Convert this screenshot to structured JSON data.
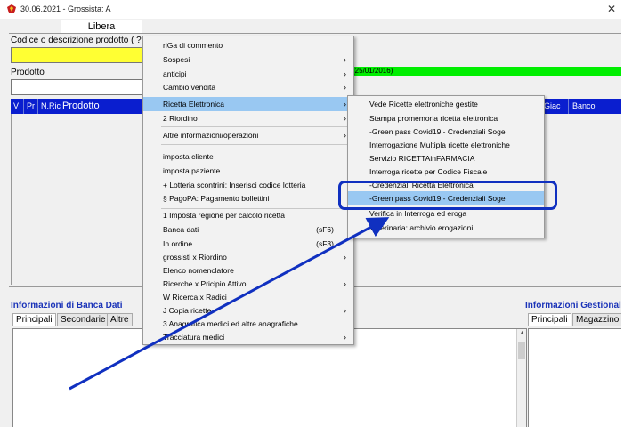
{
  "window": {
    "title": "30.06.2021 - Grossista: A",
    "close_glyph": "✕",
    "accent": "#0a1ecf"
  },
  "tabs": {
    "active": "Libera"
  },
  "form": {
    "code_label": "Codice o descrizione prodotto ( ?",
    "product_label": "Prodotto",
    "green_text": "(25/01/2016)"
  },
  "grid": {
    "columns": [
      "V",
      "Pr",
      "N.Ric",
      "Prodotto",
      "Giac",
      "Banco"
    ]
  },
  "bottom_left": {
    "title": "Informazioni di Banca Dati",
    "tabs": [
      "Principali",
      "Secondarie",
      "Altre"
    ]
  },
  "bottom_right": {
    "title": "Informazioni Gestional",
    "tabs": [
      "Principali",
      "Magazzino"
    ]
  },
  "context_menu": {
    "items": [
      {
        "label": "riGa di commento",
        "arrow": ""
      },
      {
        "label": "Sospesi",
        "arrow": "›"
      },
      {
        "label": "anticipi",
        "arrow": "›"
      },
      {
        "label": "Cambio vendita",
        "arrow": "›"
      },
      {
        "label": "Ricetta Elettronica",
        "arrow": "›"
      },
      {
        "label": "2 Riordino",
        "arrow": "›"
      },
      {
        "label": "Altre informazioni/operazioni",
        "arrow": "›"
      },
      {
        "label": "imposta cliente",
        "arrow": ""
      },
      {
        "label": "imposta paziente",
        "arrow": ""
      },
      {
        "label": "+ Lotteria scontrini: Inserisci codice lotteria",
        "arrow": ""
      },
      {
        "label": "§ PagoPA: Pagamento bollettini",
        "arrow": ""
      },
      {
        "label": "1 Imposta regione per calcolo ricetta",
        "arrow": ""
      },
      {
        "label": "Banca dati",
        "shortcut": "(sF6)"
      },
      {
        "label": "In ordine",
        "shortcut": "(sF3)"
      },
      {
        "label": "grossisti x Riordino",
        "arrow": "›"
      },
      {
        "label": "Elenco nomenclatore",
        "arrow": ""
      },
      {
        "label": "Ricerche x Pricipio Attivo",
        "arrow": "›"
      },
      {
        "label": "W Ricerca x Radici",
        "arrow": ""
      },
      {
        "label": "J Copia ricette",
        "arrow": "›"
      },
      {
        "label": "3 Anagrafica medici ed altre anagrafiche",
        "arrow": ""
      },
      {
        "label": "Tracciatura medici",
        "arrow": "›"
      }
    ]
  },
  "submenu": {
    "items": [
      {
        "label": "Vede Ricette elettroniche gestite"
      },
      {
        "label": "Stampa promemoria ricetta elettronica"
      },
      {
        "label": "-Green pass Covid19 - Credenziali Sogei"
      },
      {
        "label": "Interrogazione Multipla ricette elettroniche"
      },
      {
        "label": "Servizio RICETTAinFARMACIA"
      },
      {
        "label": "Interroga ricette per Codice Fiscale"
      },
      {
        "label": "-Credenziali Ricetta Elettronica"
      },
      {
        "label": "-Green pass Covid19 - Credenziali Sogei"
      },
      {
        "label": "Verifica in Interroga ed eroga"
      },
      {
        "label": "Veterinaria: archivio erogazioni"
      }
    ]
  }
}
